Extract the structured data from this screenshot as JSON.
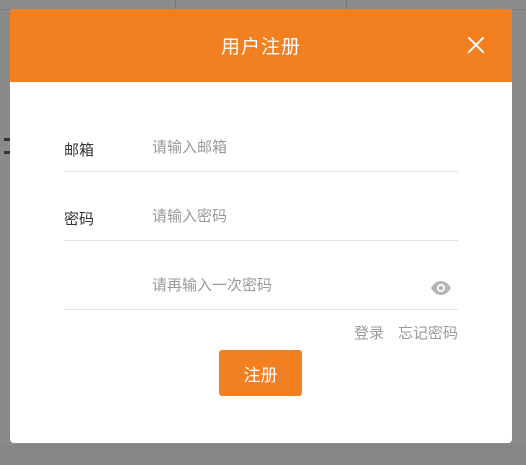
{
  "modal": {
    "title": "用户注册"
  },
  "form": {
    "email": {
      "label": "邮箱",
      "placeholder": "请输入邮箱",
      "value": ""
    },
    "password": {
      "label": "密码",
      "placeholder": "请输入密码",
      "value": ""
    },
    "confirm": {
      "label": "",
      "placeholder": "请再输入一次密码",
      "value": ""
    }
  },
  "links": {
    "login": "登录",
    "forgot": "忘记密码"
  },
  "submit_label": "注册",
  "colors": {
    "accent": "#f28020",
    "overlay": "#8a8a8a",
    "placeholder": "#999999",
    "link": "#9a9a9a"
  }
}
